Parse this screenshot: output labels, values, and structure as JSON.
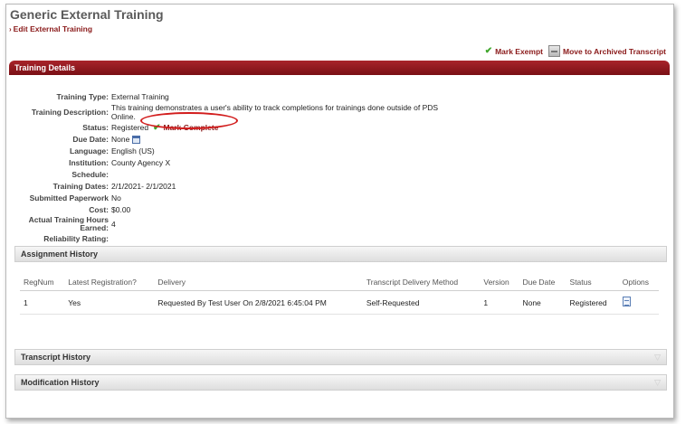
{
  "page": {
    "title": "Generic External Training",
    "breadcrumb": "Edit External Training"
  },
  "actions": {
    "mark_exempt": "Mark Exempt",
    "move_archived": "Move to Archived Transcript"
  },
  "section_title": "Training Details",
  "details": {
    "training_type": {
      "label": "Training Type:",
      "value": "External Training"
    },
    "training_description": {
      "label": "Training Description:",
      "value": "This training demonstrates a user's ability to track completions for trainings done outside of PDS Online."
    },
    "status": {
      "label": "Status:",
      "value": "Registered",
      "mark_complete": "Mark Complete"
    },
    "due_date": {
      "label": "Due Date:",
      "value": "None"
    },
    "language": {
      "label": "Language:",
      "value": "English (US)"
    },
    "institution": {
      "label": "Institution:",
      "value": "County Agency X"
    },
    "schedule": {
      "label": "Schedule:",
      "value": ""
    },
    "training_dates": {
      "label": "Training Dates:",
      "value": "2/1/2021- 2/1/2021"
    },
    "submitted_paperwork": {
      "label": "Submitted Paperwork",
      "value": "No"
    },
    "cost": {
      "label": "Cost:",
      "value": "$0.00"
    },
    "actual_hours": {
      "label": "Actual Training Hours Earned:",
      "value": "4"
    },
    "reliability_rating": {
      "label": "Reliability Rating:",
      "value": ""
    }
  },
  "assignment_history": {
    "title": "Assignment History",
    "columns": [
      "RegNum",
      "Latest Registration?",
      "Delivery",
      "Transcript Delivery Method",
      "Version",
      "Due Date",
      "Status",
      "Options"
    ],
    "rows": [
      [
        "1",
        "Yes",
        "Requested By Test User On 2/8/2021 6:45:04 PM",
        "Self-Requested",
        "1",
        "None",
        "Registered"
      ]
    ]
  },
  "transcript_history": {
    "title": "Transcript History"
  },
  "modification_history": {
    "title": "Modification History"
  },
  "colors": {
    "accent": "#8a1a1a",
    "header_bar": "#a8242a",
    "check": "#3fa62b",
    "highlight_oval": "#d21d1d"
  }
}
